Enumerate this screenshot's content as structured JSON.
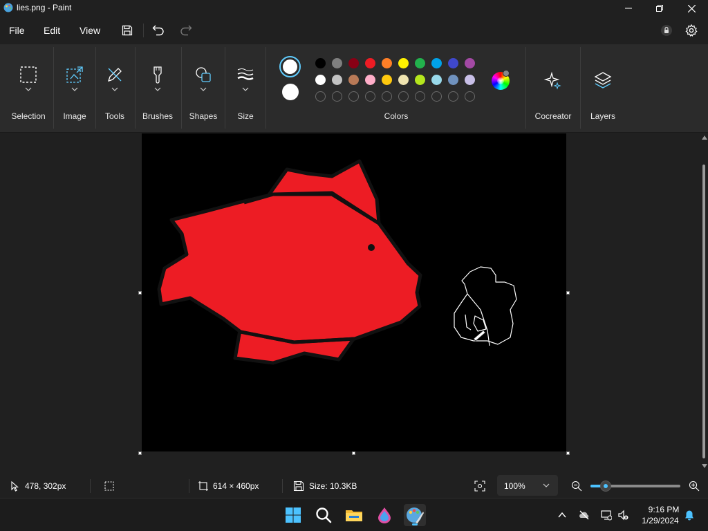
{
  "window": {
    "title": "lies.png - Paint"
  },
  "menu": {
    "file": "File",
    "edit": "Edit",
    "view": "View"
  },
  "ribbon": {
    "groups": {
      "selection": "Selection",
      "image": "Image",
      "tools": "Tools",
      "brushes": "Brushes",
      "shapes": "Shapes",
      "size": "Size",
      "colors": "Colors",
      "cocreator": "Cocreator",
      "layers": "Layers"
    },
    "primary_color": "#ffffff",
    "secondary_color": "#ffffff",
    "palette_row1": [
      "#000000",
      "#7f7f7f",
      "#880015",
      "#ed1c24",
      "#ff7f27",
      "#fff200",
      "#22b14c",
      "#00a2e8",
      "#3f48cc",
      "#a349a4"
    ],
    "palette_row2": [
      "#ffffff",
      "#c3c3c3",
      "#b97a57",
      "#ffaec9",
      "#ffc90e",
      "#efe4b0",
      "#b5e61d",
      "#99d9ea",
      "#7092be",
      "#c8bfe7"
    ]
  },
  "canvas": {
    "background": "#000000",
    "fill_color": "#ed1c24"
  },
  "status": {
    "cursor_pos": "478, 302px",
    "canvas_size": "614 × 460px",
    "file_size": "Size: 10.3KB",
    "zoom": "100%",
    "zoom_level": 0.17
  },
  "taskbar": {
    "time": "9:16 PM",
    "date": "1/29/2024"
  }
}
